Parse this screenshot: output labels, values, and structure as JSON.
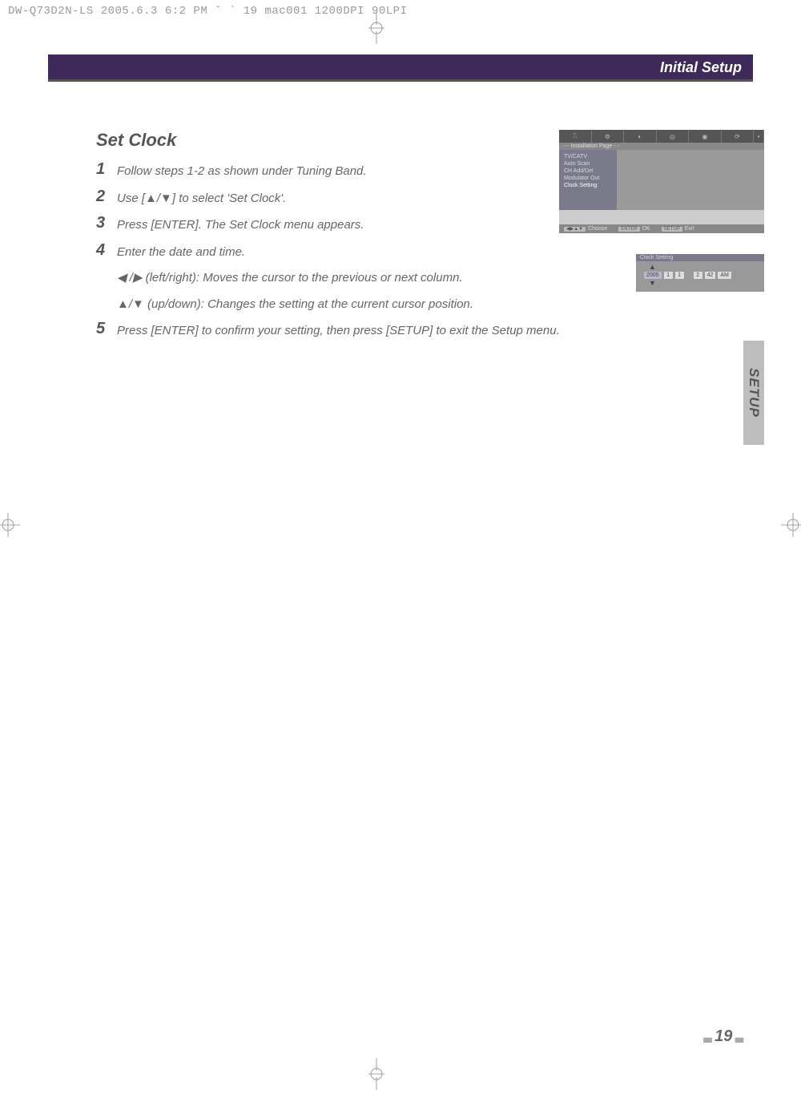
{
  "print_header": "DW-Q73D2N-LS  2005.6.3 6:2 PM  ˘  ` 19   mac001  1200DPI 90LPI",
  "header_title": "Initial Setup",
  "section_title": "Set Clock",
  "steps": {
    "s1": "Follow steps 1-2 as shown under Tuning Band.",
    "s2": "Use [▲/▼] to select 'Set Clock'.",
    "s3": "Press [ENTER]. The Set Clock menu appears.",
    "s4": "Enter the date and time.",
    "s4a": "◀ /▶ (left/right): Moves the cursor to the previous or next column.",
    "s4b": "▲/▼ (up/down): Changes the setting at the current cursor position.",
    "s5": "Press [ENTER] to confirm your setting, then press [SETUP] to exit the Setup menu."
  },
  "osd": {
    "subtitle": "- - Installation Page - -",
    "menu": {
      "i1": "TV/CATV",
      "i2": "Auto Scan",
      "i3": "CH Add/Del",
      "i4": "Modulator Out",
      "i5": "Clock Setting"
    },
    "footer": {
      "choose": "Choose",
      "ok": "OK",
      "exit": "Exit",
      "enter_btn": "ENTER",
      "setup_btn": "SETUP",
      "nav_btn": "◀▶▲▼"
    }
  },
  "clock": {
    "title": "Clock Setting",
    "year": "2005",
    "mm": "1",
    "dd": "1",
    "hh": "2",
    "min": "42",
    "ampm": "AM"
  },
  "side_tab": "SETUP",
  "page_number": "19"
}
